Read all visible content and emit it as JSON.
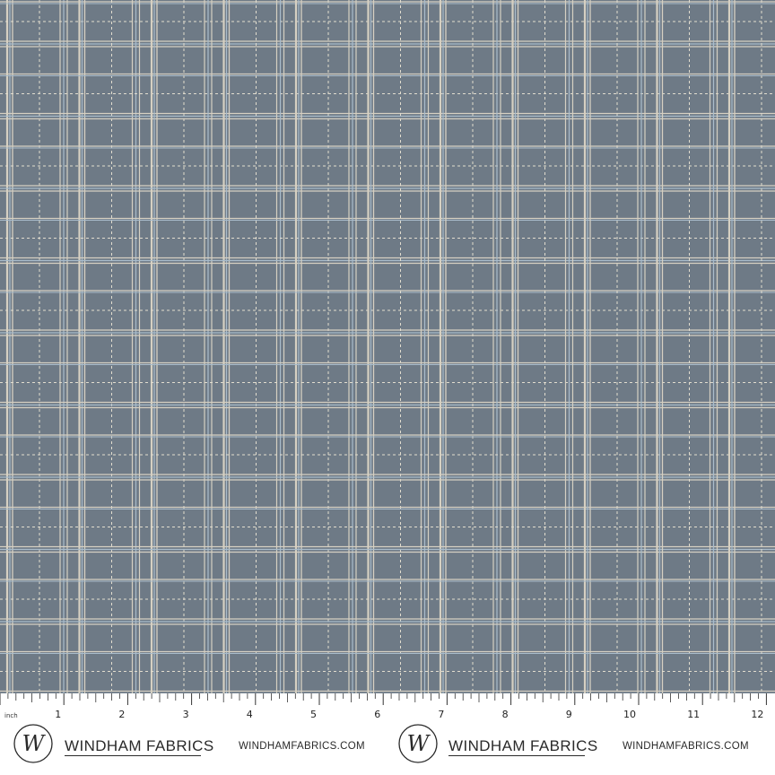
{
  "fabric": {
    "background_color": "#6e7a86",
    "cream_line_color": "#d6d0c2",
    "blue_line_color": "#a9bccb",
    "stitch_color": "#e2ddcf",
    "pattern": "plaid"
  },
  "ruler": {
    "unit_label": "inch",
    "numbers": [
      "1",
      "2",
      "3",
      "4",
      "5",
      "6",
      "7",
      "8",
      "9",
      "10",
      "11",
      "12"
    ]
  },
  "branding": [
    {
      "logo_letter": "W",
      "brand_name": "WINDHAM FABRICS",
      "website": "WINDHAMFABRICS.COM"
    },
    {
      "logo_letter": "W",
      "brand_name": "WINDHAM FABRICS",
      "website": "WINDHAMFABRICS.COM"
    }
  ]
}
